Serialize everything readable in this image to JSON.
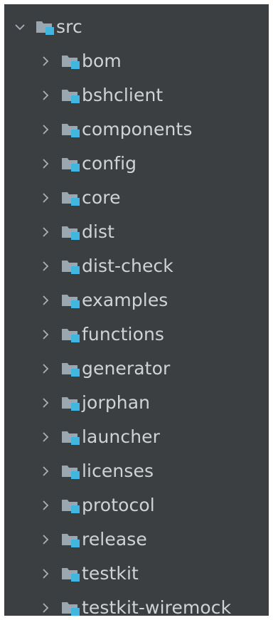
{
  "project_tree": {
    "root": {
      "label": "src",
      "expanded": true,
      "icon": "source-folder-icon"
    },
    "children": [
      {
        "label": "bom",
        "expanded": false
      },
      {
        "label": "bshclient",
        "expanded": false
      },
      {
        "label": "components",
        "expanded": false
      },
      {
        "label": "config",
        "expanded": false
      },
      {
        "label": "core",
        "expanded": false
      },
      {
        "label": "dist",
        "expanded": false
      },
      {
        "label": "dist-check",
        "expanded": false
      },
      {
        "label": "examples",
        "expanded": false
      },
      {
        "label": "functions",
        "expanded": false
      },
      {
        "label": "generator",
        "expanded": false
      },
      {
        "label": "jorphan",
        "expanded": false
      },
      {
        "label": "launcher",
        "expanded": false
      },
      {
        "label": "licenses",
        "expanded": false
      },
      {
        "label": "protocol",
        "expanded": false
      },
      {
        "label": "release",
        "expanded": false
      },
      {
        "label": "testkit",
        "expanded": false
      },
      {
        "label": "testkit-wiremock",
        "expanded": false
      }
    ]
  },
  "colors": {
    "panel_background": "#3c3f41",
    "text": "#d0d3d6",
    "folder_gray": "#9aa7b0",
    "module_badge_blue": "#40b6e0",
    "chevron": "#a9b0b6"
  }
}
